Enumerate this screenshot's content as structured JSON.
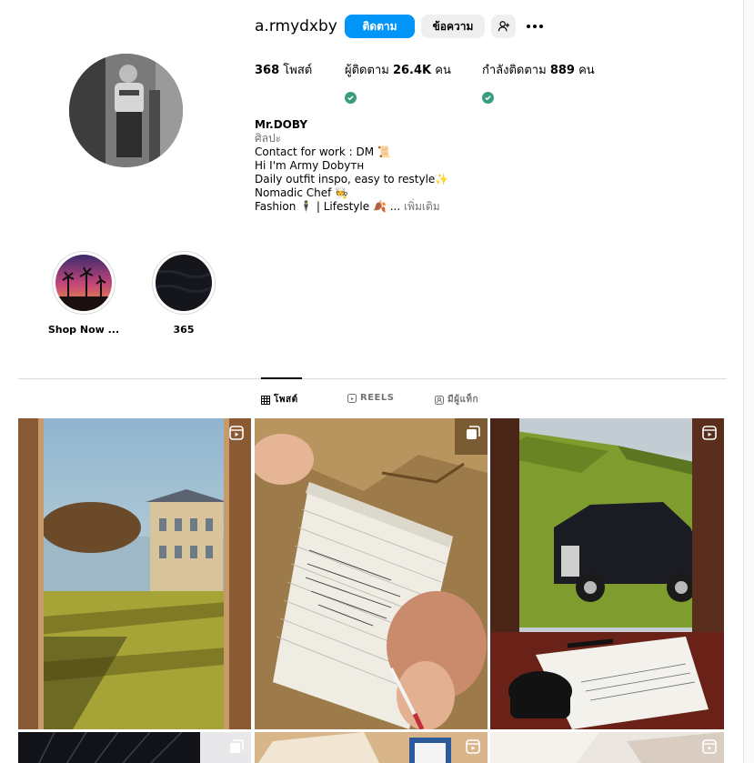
{
  "profile": {
    "username": "a.rmydxby",
    "follow_label": "ติดตาม",
    "message_label": "ข้อความ",
    "posts_count": "368",
    "posts_label": "โพสต์",
    "followers_label": "ผู้ติดตาม",
    "followers_count": "26.4K",
    "followers_unit": "คน",
    "following_label": "กำลังติดตาม",
    "following_count": "889",
    "following_unit": "คน"
  },
  "bio": {
    "name": "Mr.DOBY",
    "category": "ศิลปะ",
    "line1": "Contact for work : DM 📜",
    "line2": "Hi I'm Army Dobyтн",
    "line3": "Daily outfit inspo, easy to restyle✨",
    "line4": "Nomadic Chef 🧑‍🍳",
    "line5": "Fashion 🕴 | Lifestyle 🍂 ...",
    "more": "เพิ่มเติม"
  },
  "highlights": [
    {
      "label": "Shop Now ..."
    },
    {
      "label": "365"
    }
  ],
  "tabs": {
    "posts": "โพสต์",
    "reels": "REELS",
    "tagged": "มีผู้แท็ก"
  },
  "colors": {
    "accent": "#0095f6",
    "verified": "#3a9c7e",
    "muted": "#737373",
    "button_gray": "#efefef"
  },
  "icons": {
    "suggest": "add-user-icon",
    "more": "more-dots-icon",
    "reel": "reel-icon",
    "carousel": "carousel-icon",
    "grid": "grid-icon",
    "tag": "tag-icon"
  }
}
